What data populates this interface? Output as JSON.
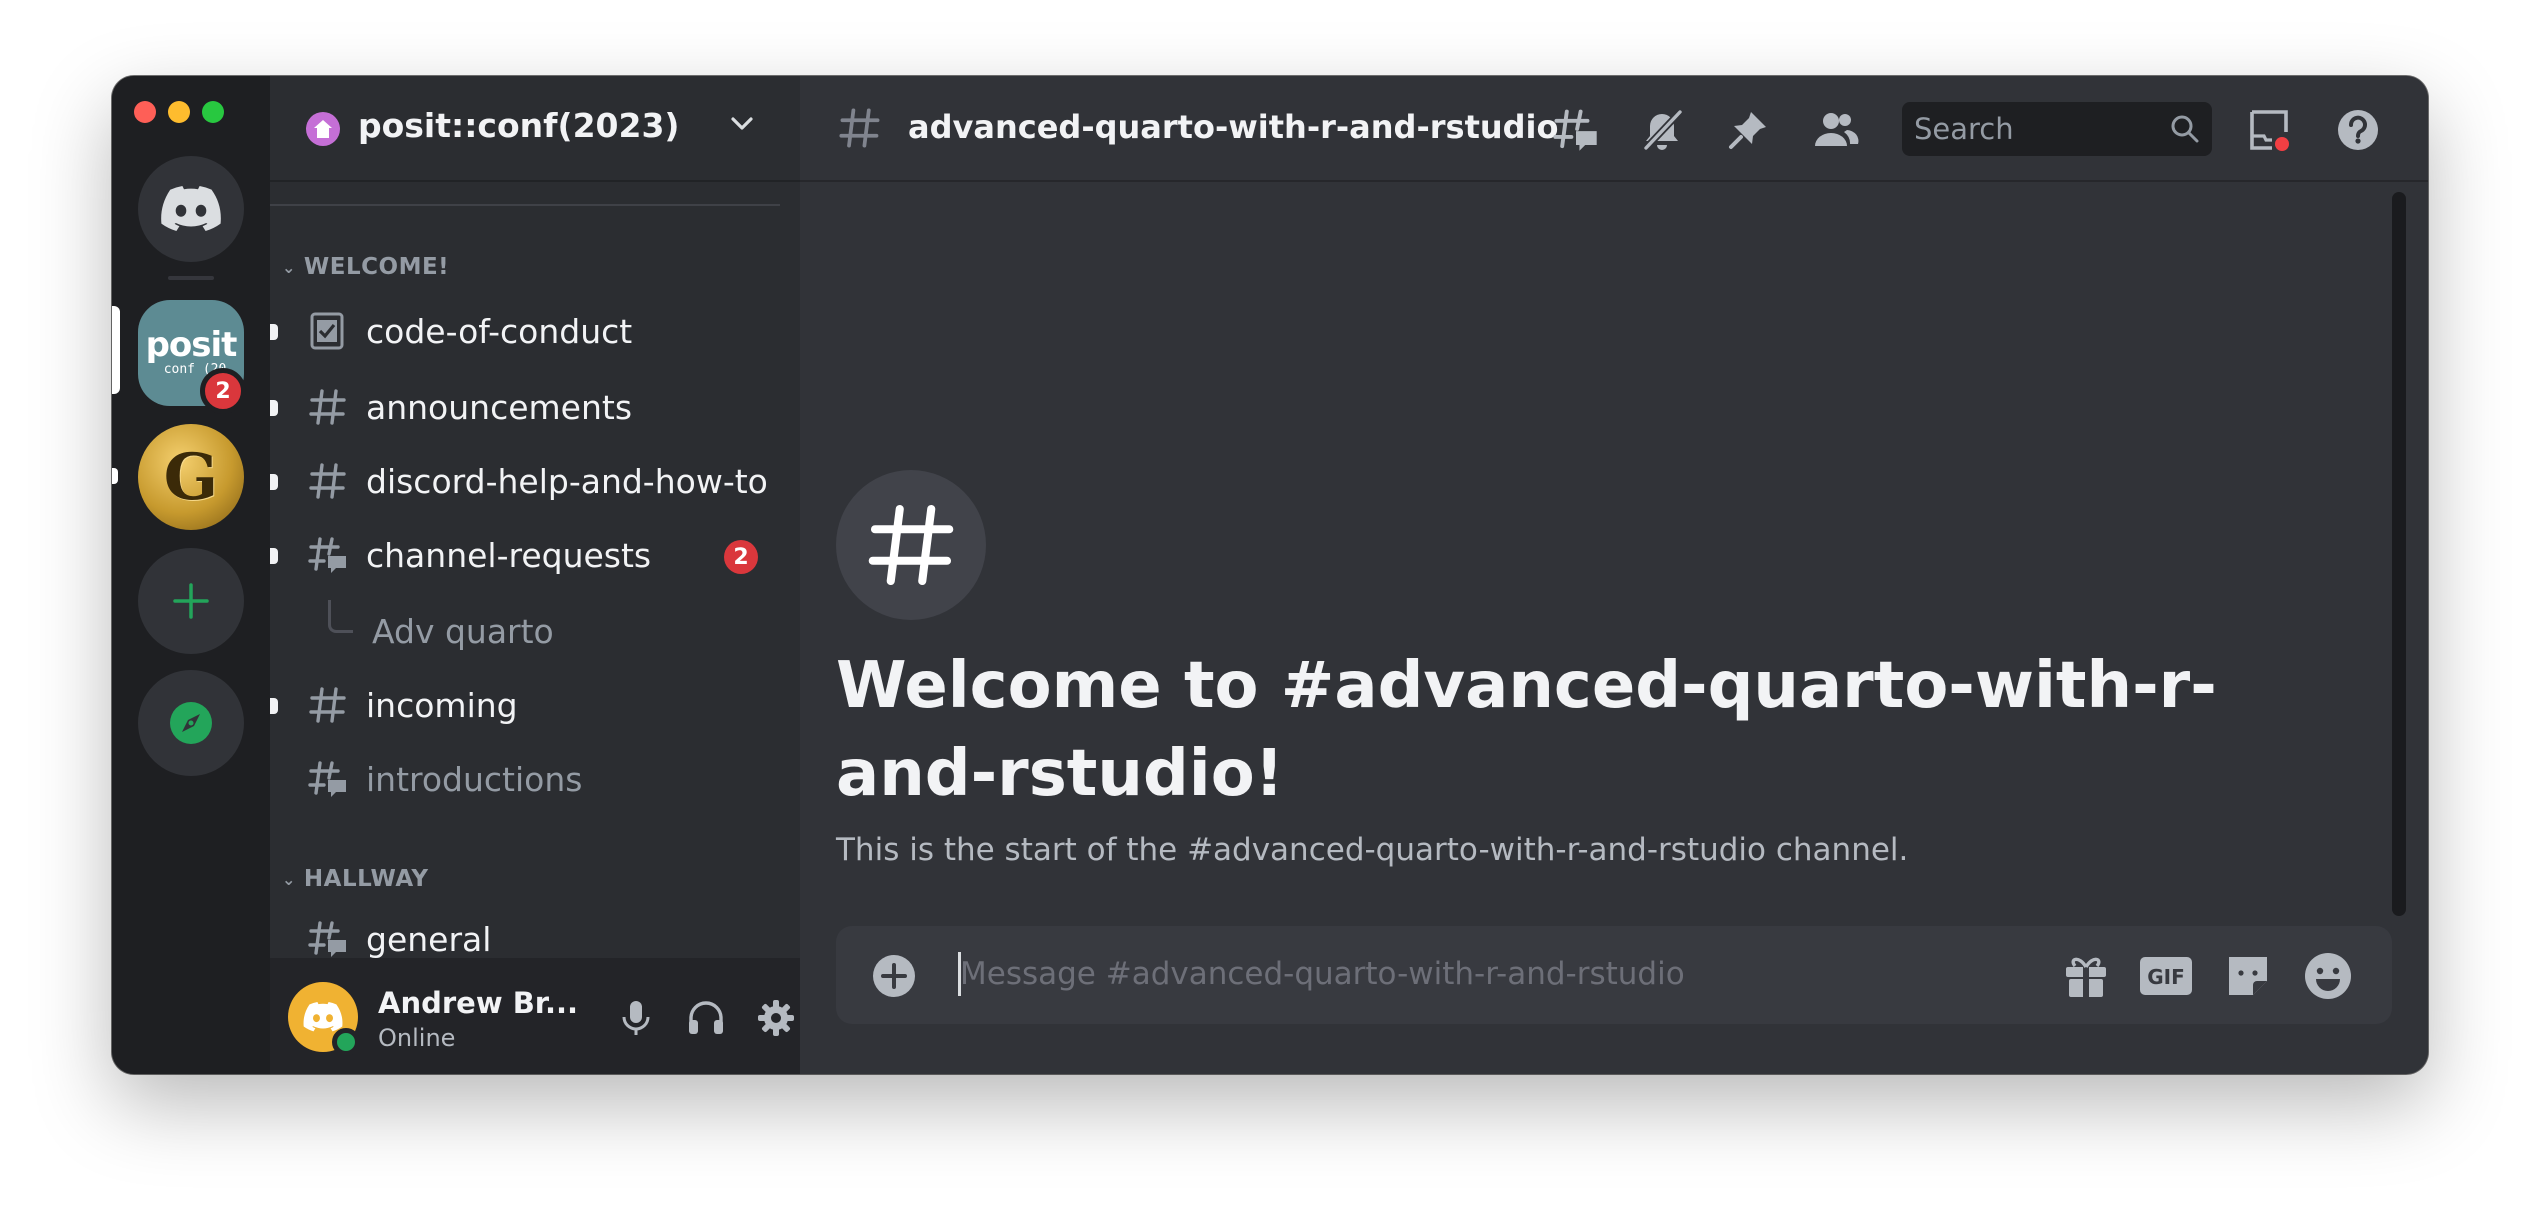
{
  "server_rail": {
    "servers": [
      {
        "name": "Direct Messages",
        "icon": "discord-logo-icon"
      },
      {
        "name": "posit::conf(2023)",
        "text": "posit",
        "subtext": "conf (20",
        "badge": "2",
        "selected": true
      },
      {
        "name": "G server",
        "letter": "G",
        "unread": true
      }
    ],
    "add_server_icon": "plus-icon",
    "explore_icon": "compass-icon"
  },
  "guild": {
    "name": "posit::conf(2023)"
  },
  "categories": [
    {
      "name": "WELCOME!",
      "items": [
        {
          "type": "rules",
          "name": "code-of-conduct",
          "unread": true
        },
        {
          "type": "text",
          "name": "announcements",
          "unread": true
        },
        {
          "type": "text",
          "name": "discord-help-and-how-to",
          "unread": true
        },
        {
          "type": "forum",
          "name": "channel-requests",
          "unread": true,
          "badge": "2"
        },
        {
          "type": "thread",
          "name": "Adv quarto"
        },
        {
          "type": "text",
          "name": "incoming",
          "unread": true
        },
        {
          "type": "forum",
          "name": "introductions",
          "muted": true
        }
      ]
    },
    {
      "name": "HALLWAY",
      "items": [
        {
          "type": "forum",
          "name": "general",
          "unread": true
        }
      ]
    }
  ],
  "user": {
    "name": "Andrew Br...",
    "status": "Online"
  },
  "channel": {
    "name": "advanced-quarto-with-r-and-rstudio"
  },
  "header": {
    "search_placeholder": "Search"
  },
  "welcome": {
    "title": "Welcome to #advanced-quarto-with-r-and-rstudio!",
    "subtitle": "This is the start of the #advanced-quarto-with-r-and-rstudio channel."
  },
  "composer": {
    "placeholder": "Message #advanced-quarto-with-r-and-rstudio"
  },
  "colors": {
    "background": "#313338",
    "sidebar": "#2b2d31",
    "rail": "#1e1f22",
    "badge": "#da373c",
    "online": "#23a55a",
    "add_green": "#23a55a"
  }
}
